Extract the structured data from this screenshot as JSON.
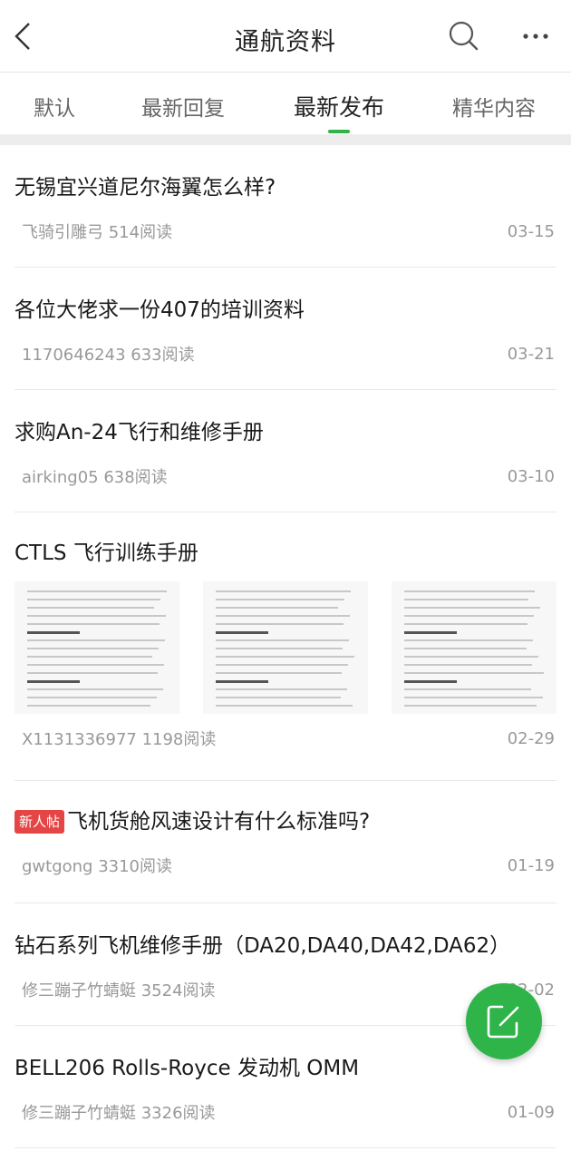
{
  "header": {
    "title": "通航资料",
    "back_icon": "chevron-left-icon",
    "search_icon": "search-icon",
    "more_icon": "more-horizontal-icon"
  },
  "tabs": [
    {
      "label": "默认",
      "active": false
    },
    {
      "label": "最新回复",
      "active": false
    },
    {
      "label": "最新发布",
      "active": true
    },
    {
      "label": "精华内容",
      "active": false
    }
  ],
  "accent_color": "#2fb44a",
  "badge_color": "#e64545",
  "posts": [
    {
      "title": "无锡宜兴道尼尔海翼怎么样?",
      "meta": "飞骑引雕弓 514阅读",
      "date": "03-15"
    },
    {
      "title": "各位大佬求一份407的培训资料",
      "meta": "1170646243 633阅读",
      "date": "03-21"
    },
    {
      "title": "求购An-24飞行和维修手册",
      "meta": "airking05 638阅读",
      "date": "03-10"
    },
    {
      "title": "CTLS 飞行训练手册",
      "meta": "X1131336977 1198阅读",
      "date": "02-29",
      "has_images": true
    },
    {
      "badge": "新人帖",
      "title": "飞机货舱风速设计有什么标准吗?",
      "meta": "gwtgong 3310阅读",
      "date": "01-19"
    },
    {
      "title": "钻石系列飞机维修手册（DA20,DA40,DA42,DA62）",
      "meta": "修三蹦子竹蜻蜓 3524阅读",
      "date": "02-02"
    },
    {
      "title": "BELL206 Rolls-Royce 发动机 OMM",
      "meta": "修三蹦子竹蜻蜓 3326阅读",
      "date": "01-09"
    }
  ],
  "fab_icon": "compose-icon"
}
